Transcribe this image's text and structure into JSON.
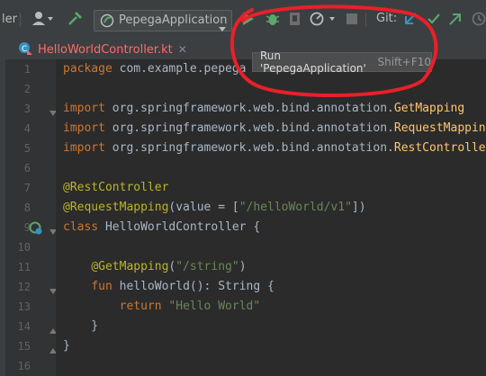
{
  "toolbar": {
    "left_cut_label": "ler",
    "run_config": "PepegaApplication",
    "git_label": "Git:"
  },
  "tab": {
    "file_name": "HelloWorldController.kt"
  },
  "tooltip": {
    "text": "Run 'PepegaApplication'",
    "shortcut": "Shift+F10"
  },
  "code": {
    "lines": [
      {
        "n": "1",
        "t": "package com.example.pepega"
      },
      {
        "n": "2",
        "t": ""
      },
      {
        "n": "3",
        "t": "import org.springframework.web.bind.annotation.GetMapping"
      },
      {
        "n": "4",
        "t": "import org.springframework.web.bind.annotation.RequestMapping"
      },
      {
        "n": "5",
        "t": "import org.springframework.web.bind.annotation.RestController"
      },
      {
        "n": "6",
        "t": ""
      },
      {
        "n": "7",
        "t": "@RestController"
      },
      {
        "n": "8",
        "t": "@RequestMapping(value = [\"/helloWorld/v1\"])"
      },
      {
        "n": "9",
        "t": "class HelloWorldController {"
      },
      {
        "n": "10",
        "t": ""
      },
      {
        "n": "11",
        "t": "    @GetMapping(\"/string\")"
      },
      {
        "n": "12",
        "t": "    fun helloWorld(): String {"
      },
      {
        "n": "13",
        "t": "        return \"Hello World\""
      },
      {
        "n": "14",
        "t": "    }"
      },
      {
        "n": "15",
        "t": "}"
      },
      {
        "n": "16",
        "t": ""
      }
    ]
  },
  "colors": {
    "keyword": "#cc7832",
    "annotation": "#bbb529",
    "string": "#6a8759",
    "function": "#ffc66d",
    "run_green": "#59a869",
    "highlight_red": "#e8202a"
  },
  "icons": [
    "user-icon",
    "hammer-icon",
    "run-config-icon",
    "run-icon",
    "debug-icon",
    "coverage-icon",
    "profile-icon",
    "stop-icon",
    "git-update-icon",
    "git-commit-icon",
    "git-push-icon",
    "history-icon",
    "kotlin-file-icon",
    "close-icon",
    "spring-bean-icon",
    "fold-icon"
  ]
}
